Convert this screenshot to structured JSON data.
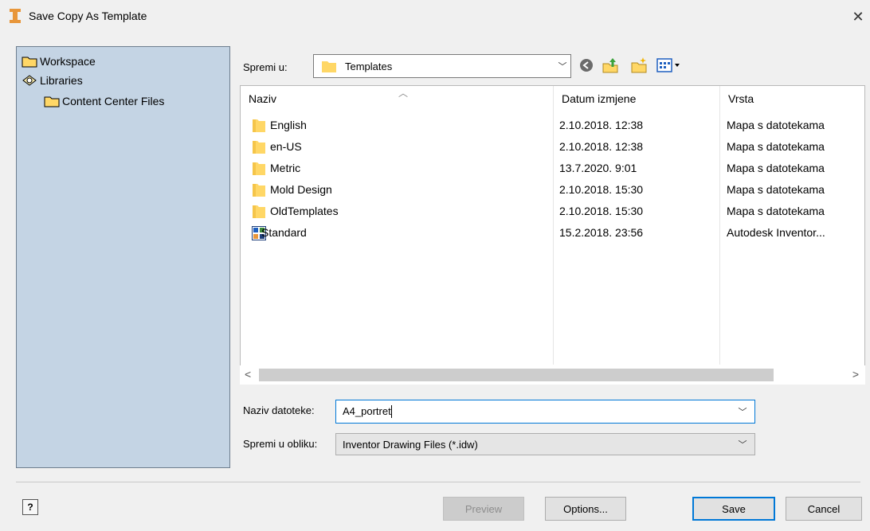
{
  "window": {
    "title": "Save Copy As Template",
    "close_label": "✕"
  },
  "sidebar": {
    "items": [
      {
        "label": "Workspace",
        "icon": "folder-icon"
      },
      {
        "label": "Libraries",
        "icon": "library-icon"
      },
      {
        "label": "Content Center Files",
        "icon": "folder-icon"
      }
    ]
  },
  "save_in": {
    "label": "Spremi u:",
    "value": "Templates"
  },
  "file_list": {
    "columns": [
      "Naziv",
      "Datum izmjene",
      "Vrsta"
    ],
    "rows": [
      {
        "name": "English",
        "date": "2.10.2018. 12:38",
        "type": "Mapa s datotekama",
        "icon": "folder-icon"
      },
      {
        "name": "en-US",
        "date": "2.10.2018. 12:38",
        "type": "Mapa s datotekama",
        "icon": "folder-icon"
      },
      {
        "name": "Metric",
        "date": "13.7.2020. 9:01",
        "type": "Mapa s datotekama",
        "icon": "folder-icon"
      },
      {
        "name": "Mold Design",
        "date": "2.10.2018. 15:30",
        "type": "Mapa s datotekama",
        "icon": "folder-icon"
      },
      {
        "name": "OldTemplates",
        "date": "2.10.2018. 15:30",
        "type": "Mapa s datotekama",
        "icon": "folder-icon"
      },
      {
        "name": "Standard",
        "date": "15.2.2018. 23:56",
        "type": "Autodesk Inventor...",
        "icon": "inventor-file-icon"
      }
    ]
  },
  "file_name": {
    "label": "Naziv datoteke:",
    "value": "A4_portret"
  },
  "file_type": {
    "label": "Spremi u obliku:",
    "value": "Inventor Drawing Files (*.idw)"
  },
  "buttons": {
    "preview": "Preview",
    "options": "Options...",
    "save": "Save",
    "cancel": "Cancel",
    "help": "?"
  },
  "colors": {
    "accent": "#0078d7",
    "sidebar_bg": "#c4d4e4",
    "folder": "#ffd766"
  }
}
